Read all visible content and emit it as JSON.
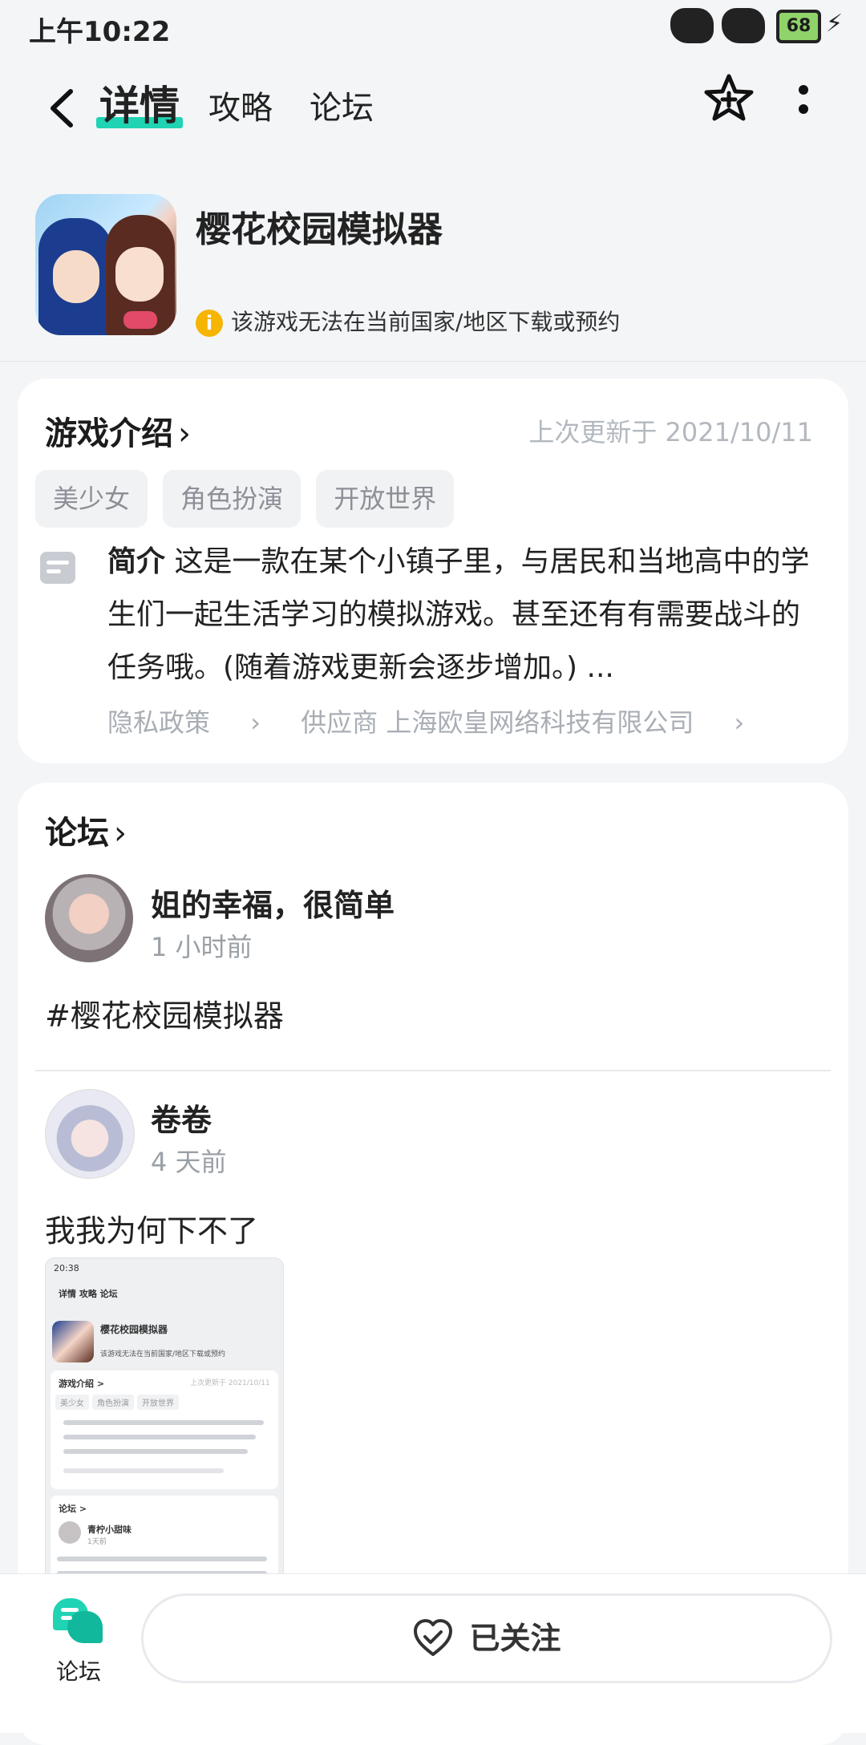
{
  "status_bar": {
    "time": "上午10:22",
    "battery": "68"
  },
  "nav": {
    "tabs": [
      "详情",
      "攻略",
      "论坛"
    ]
  },
  "game": {
    "title": "樱花校园模拟器",
    "warning": "该游戏无法在当前国家/地区下载或预约"
  },
  "intro": {
    "title": "游戏介绍",
    "updated": "上次更新于 2021/10/11",
    "tags": [
      "美少女",
      "角色扮演",
      "开放世界"
    ],
    "desc_label": "简介",
    "desc_text": "这是一款在某个小镇子里，与居民和当地高中的学生们一起生活学习的模拟游戏。甚至还有有需要战斗的任务哦。(随着游戏更新会逐步增加。) ...",
    "privacy": "隐私政策",
    "supplier": "供应商 上海欧皇网络科技有限公司"
  },
  "forum": {
    "title": "论坛",
    "posts": [
      {
        "author": "姐的幸福，很简单",
        "time": "1 小时前",
        "body": "#樱花校园模拟器"
      },
      {
        "author": "卷卷",
        "time": "4 天前",
        "body": "我我为何下不了"
      }
    ],
    "thumb": {
      "time": "20:38",
      "tabs": "详情  攻略  论坛",
      "title": "樱花校园模拟器",
      "warning": "该游戏无法在当前国家/地区下载或预约",
      "intro": "游戏介绍 >",
      "updated": "上次更新于 2021/10/11",
      "tags": [
        "美少女",
        "角色扮演",
        "开放世界"
      ],
      "forum": "论坛 >",
      "user": "青柠小甜味",
      "user_time": "1天前"
    }
  },
  "bottom": {
    "forum_label": "论坛",
    "follow_label": "已关注"
  },
  "colors": {
    "accent": "#1fd3b3",
    "warning": "#f6b500"
  },
  "icons": {
    "back": "chevron-left-icon",
    "star": "star-plus-icon",
    "more": "more-vertical-icon",
    "follow": "heart-check-icon"
  }
}
